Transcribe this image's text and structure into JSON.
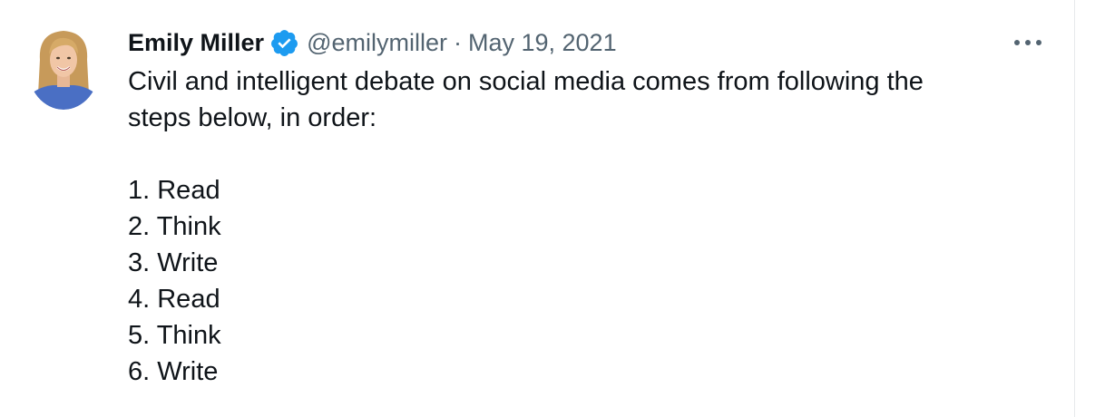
{
  "tweet": {
    "author": {
      "display_name": "Emily Miller",
      "handle": "@emilymiller",
      "verified": true,
      "avatar_icon": "profile-photo"
    },
    "separator": "·",
    "date": "May 19, 2021",
    "more_icon": "more-horizontal-icon",
    "text_lines": [
      "Civil and intelligent debate on social media comes from following the",
      "steps below, in order:"
    ],
    "steps": [
      "1. Read",
      "2. Think",
      "3. Write",
      "4. Read",
      "5. Think",
      "6. Write"
    ]
  },
  "colors": {
    "verified_badge": "#1d9bf0",
    "secondary_text": "#536471",
    "primary_text": "#0f1419"
  }
}
